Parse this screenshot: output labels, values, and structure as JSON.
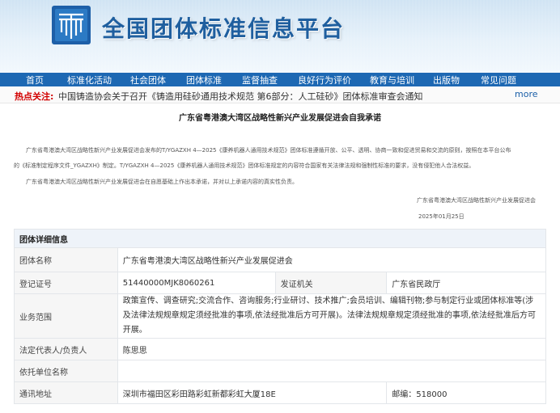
{
  "header": {
    "site_title": "全国团体标准信息平台",
    "logo_icon": "book-globe-logo-icon"
  },
  "nav": {
    "items": [
      "首页",
      "标准化活动",
      "社会团体",
      "团体标准",
      "监督抽查",
      "良好行为评价",
      "教育与培训",
      "出版物",
      "常见问题"
    ]
  },
  "hot": {
    "label": "热点关注:",
    "text": "中国铸造协会关于召开《铸造用硅砂通用技术规范 第6部分：人工硅砂》团体标准审查会通知",
    "more": "more"
  },
  "commitment": {
    "title": "广东省粤港澳大湾区战略性新兴产业发展促进会自我承诺",
    "paragraphs": [
      "广东省粤港澳大湾区战略性新兴产业发展促进会发布的T/YGAZXH 4—2025《康养机器人通用技术规范》团体标准遵循开放、公平、透明、协商一致和促进贸易和交流的原则，按照在本平台公布",
      "的《标准制定程序文件_YGAZXH》制定。T/YGAZXH 4—2025《康养机器人通用技术规范》团体标准规定的内容符合国家有关法律法规和强制性标准的要求，没有侵犯他人合法权益。",
      "广东省粤港澳大湾区战略性新兴产业发展促进会在自愿基础上作出本承诺，并对以上承诺内容的真实性负责。"
    ],
    "signature_org": "广东省粤港澳大湾区战略性新兴产业发展促进会",
    "signature_date": "2025年01月25日"
  },
  "details": {
    "section_title": "团体详细信息",
    "name_label": "团体名称",
    "name_value": "广东省粤港澳大湾区战略性新兴产业发展促进会",
    "reg_label": "登记证号",
    "reg_value": "51440000MJK8060261",
    "issuer_label": "发证机关",
    "issuer_value": "广东省民政厅",
    "scope_label": "业务范围",
    "scope_value": "政策宣传、调查研究;交流合作、咨询服务;行业研讨、技术推广;会员培训、编辑刊物;参与制定行业或团体标准等(涉及法律法规规章规定须经批准的事项,依法经批准后方可开展)。法律法规规章规定须经批准的事项,依法经批准后方可开展。",
    "rep_label": "法定代表人/负责人",
    "rep_value": "陈思思",
    "unit_label": "依托单位名称",
    "unit_value": "",
    "addr_label": "通讯地址",
    "addr_value": "深圳市福田区彩田路彩虹新都彩虹大厦18E",
    "zip_value": "邮编：518000"
  }
}
